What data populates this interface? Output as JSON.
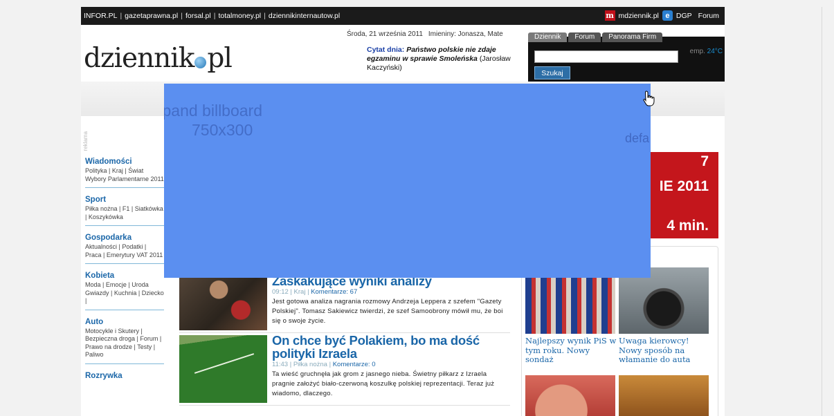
{
  "topbar": {
    "links": [
      "INFOR.PL",
      "gazetaprawna.pl",
      "forsal.pl",
      "totalmoney.pl",
      "dziennikinternautow.pl"
    ],
    "right": {
      "mdziennik": "mdziennik.pl",
      "dgp": "DGP",
      "forum": "Forum"
    }
  },
  "header": {
    "logo_left": "dziennik",
    "logo_right": "pl",
    "date": "Środa, 21 września 2011",
    "names": "Imieniny: Jonasza, Mate",
    "quote_label": "Cytat dnia:",
    "quote_text": "Państwo polskie nie zdaje egzaminu w sprawie Smoleńska",
    "quote_author": "(Jarosław Kaczyński)",
    "temp_label": "emp.",
    "temp_value": "24°C"
  },
  "search": {
    "tabs": [
      "Dziennik",
      "Forum",
      "Panorama Firm"
    ],
    "button": "Szukaj",
    "value": ""
  },
  "reklama": "reklama",
  "sidebar": [
    {
      "title": "Wiadomości",
      "links": "Polityka | Kraj | Świat Wybory Parlamentarne 2011"
    },
    {
      "title": "Sport",
      "links": "Piłka nożna | F1 | Siatkówka | Koszykówka"
    },
    {
      "title": "Gospodarka",
      "links": "Aktualności | Podatki | Praca | Emerytury VAT 2011"
    },
    {
      "title": "Kobieta",
      "links": "Moda | Emocje | Uroda Gwiazdy | Kuchnia | Dziecko |"
    },
    {
      "title": "Auto",
      "links": "Motocykle i Skutery | Bezpieczna droga | Forum | Prawo na drodze | Testy | Paliwo"
    },
    {
      "title": "Rozrywka",
      "links": ""
    }
  ],
  "articles": [
    {
      "title": "Co Sakiewicz dotyczą ku Leppera? Zaskakujące wyniki analizy",
      "time": "09:12",
      "category": "Kraj",
      "comments": "Komentarze: 67",
      "lead": "Jest gotowa analiza nagrania rozmowy Andrzeja Leppera z szefem \"Gazety Polskiej\". Tomasz Sakiewicz twierdzi, że szef Samoobrony mówił mu, że boi się o swoje życie."
    },
    {
      "title": "On chce być Polakiem, bo ma dość polityki Izraela",
      "time": "11:43",
      "category": "Piłka nożna",
      "comments": "Komentarze: 0",
      "lead": "Ta wieść gruchnęła jak grom z jasnego nieba. Świetny piłkarz z Izraela pragnie założyć biało-czerwoną koszulkę polskiej reprezentacji. Teraz już wiadomo, dlaczego."
    }
  ],
  "banner": {
    "line0": "7",
    "line1": "IE 2011",
    "line2": "4 min."
  },
  "right_items": [
    {
      "caption": "Najlepszy wynik PiS w tym roku. Nowy sondaż"
    },
    {
      "caption": "Uwaga kierowcy! Nowy sposób na włamanie do auta"
    }
  ],
  "billboard": {
    "label": "xpand billboard",
    "size": "750x300",
    "default_text": "defa",
    "color": "#5b8ff0"
  }
}
